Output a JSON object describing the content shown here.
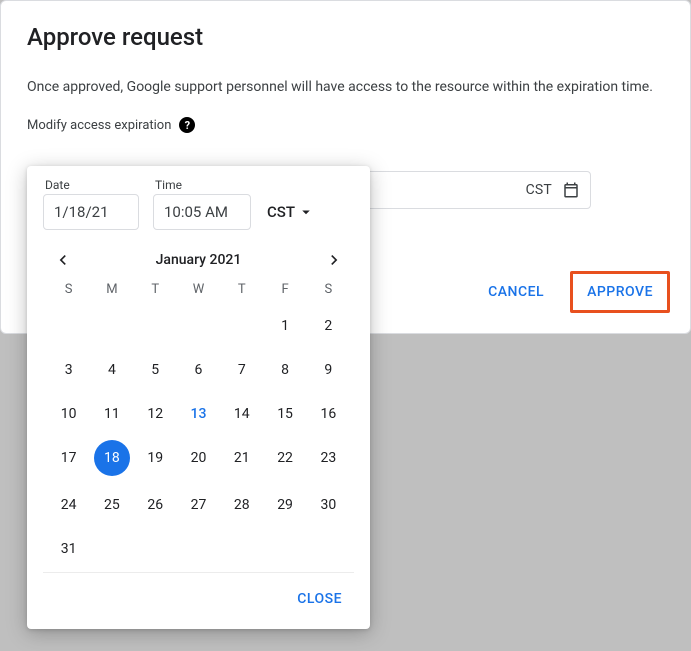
{
  "dialog": {
    "title": "Approve request",
    "description": "Once approved, Google support personnel will have access to the resource within the expiration time.",
    "modify_label": "Modify access expiration",
    "timezone": "CST",
    "cancel_label": "CANCEL",
    "approve_label": "APPROVE"
  },
  "picker": {
    "date_label": "Date",
    "date_value": "1/18/21",
    "time_label": "Time",
    "time_value": "10:05 AM",
    "timezone": "CST",
    "month_label": "January 2021",
    "dow": [
      "S",
      "M",
      "T",
      "W",
      "T",
      "F",
      "S"
    ],
    "weeks": [
      [
        "",
        "",
        "",
        "",
        "",
        "1",
        "2"
      ],
      [
        "3",
        "4",
        "5",
        "6",
        "7",
        "8",
        "9"
      ],
      [
        "10",
        "11",
        "12",
        "13",
        "14",
        "15",
        "16"
      ],
      [
        "17",
        "18",
        "19",
        "20",
        "21",
        "22",
        "23"
      ],
      [
        "24",
        "25",
        "26",
        "27",
        "28",
        "29",
        "30"
      ],
      [
        "31",
        "",
        "",
        "",
        "",
        "",
        ""
      ]
    ],
    "today_day": "13",
    "selected_day": "18",
    "close_label": "CLOSE"
  }
}
